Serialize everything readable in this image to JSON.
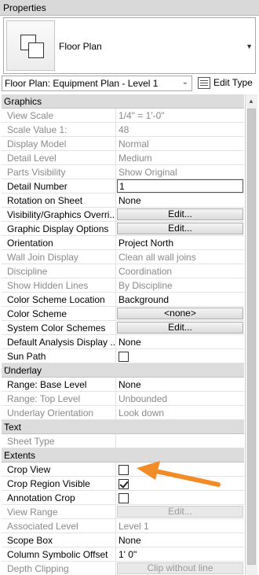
{
  "window": {
    "title": "Properties"
  },
  "type_selector": {
    "name": "Floor Plan",
    "icon": "floor-plan-icon"
  },
  "instance_selector": {
    "value": "Floor Plan: Equipment Plan - Level 1",
    "edit_type_label": "Edit Type"
  },
  "sections": [
    {
      "name": "Graphics",
      "rows": [
        {
          "name": "View Scale",
          "value": "1/4\" = 1'-0\"",
          "kind": "text",
          "disabled": true
        },
        {
          "name": "Scale Value    1:",
          "value": "48",
          "kind": "text",
          "disabled": true
        },
        {
          "name": "Display Model",
          "value": "Normal",
          "kind": "text",
          "disabled": true
        },
        {
          "name": "Detail Level",
          "value": "Medium",
          "kind": "text",
          "disabled": true
        },
        {
          "name": "Parts Visibility",
          "value": "Show Original",
          "kind": "text",
          "disabled": true
        },
        {
          "name": "Detail Number",
          "value": "1",
          "kind": "input",
          "disabled": false
        },
        {
          "name": "Rotation on Sheet",
          "value": "None",
          "kind": "text",
          "disabled": false
        },
        {
          "name": "Visibility/Graphics Overri...",
          "value": "Edit...",
          "kind": "button",
          "disabled": false
        },
        {
          "name": "Graphic Display Options",
          "value": "Edit...",
          "kind": "button",
          "disabled": false
        },
        {
          "name": "Orientation",
          "value": "Project North",
          "kind": "text",
          "disabled": false
        },
        {
          "name": "Wall Join Display",
          "value": "Clean all wall joins",
          "kind": "text",
          "disabled": true
        },
        {
          "name": "Discipline",
          "value": "Coordination",
          "kind": "text",
          "disabled": true
        },
        {
          "name": "Show Hidden Lines",
          "value": "By Discipline",
          "kind": "text",
          "disabled": true
        },
        {
          "name": "Color Scheme Location",
          "value": "Background",
          "kind": "text",
          "disabled": false
        },
        {
          "name": "Color Scheme",
          "value": "<none>",
          "kind": "button",
          "disabled": false
        },
        {
          "name": "System Color Schemes",
          "value": "Edit...",
          "kind": "button",
          "disabled": false
        },
        {
          "name": "Default Analysis Display ...",
          "value": "None",
          "kind": "text",
          "disabled": false
        },
        {
          "name": "Sun Path",
          "value": "",
          "kind": "checkbox",
          "checked": false,
          "disabled": false
        }
      ]
    },
    {
      "name": "Underlay",
      "rows": [
        {
          "name": "Range: Base Level",
          "value": "None",
          "kind": "text",
          "disabled": false
        },
        {
          "name": "Range: Top Level",
          "value": "Unbounded",
          "kind": "text",
          "disabled": true
        },
        {
          "name": "Underlay Orientation",
          "value": "Look down",
          "kind": "text",
          "disabled": true
        }
      ]
    },
    {
      "name": "Text",
      "rows": [
        {
          "name": "Sheet Type",
          "value": "",
          "kind": "text",
          "disabled": true
        }
      ]
    },
    {
      "name": "Extents",
      "rows": [
        {
          "name": "Crop View",
          "value": "",
          "kind": "checkbox",
          "checked": false,
          "disabled": false
        },
        {
          "name": "Crop Region Visible",
          "value": "",
          "kind": "checkbox",
          "checked": true,
          "disabled": false
        },
        {
          "name": "Annotation Crop",
          "value": "",
          "kind": "checkbox",
          "checked": false,
          "disabled": false
        },
        {
          "name": "View Range",
          "value": "Edit...",
          "kind": "button",
          "disabled": true
        },
        {
          "name": "Associated Level",
          "value": "Level 1",
          "kind": "text",
          "disabled": true
        },
        {
          "name": "Scope Box",
          "value": "None",
          "kind": "text",
          "disabled": false
        },
        {
          "name": "Column Symbolic Offset",
          "value": "1'  0\"",
          "kind": "text",
          "disabled": false
        },
        {
          "name": "Depth Clipping",
          "value": "Clip without line",
          "kind": "button",
          "disabled": true
        }
      ]
    }
  ],
  "annotation": {
    "icon": "orange-arrow-icon",
    "color": "#f28c28"
  }
}
